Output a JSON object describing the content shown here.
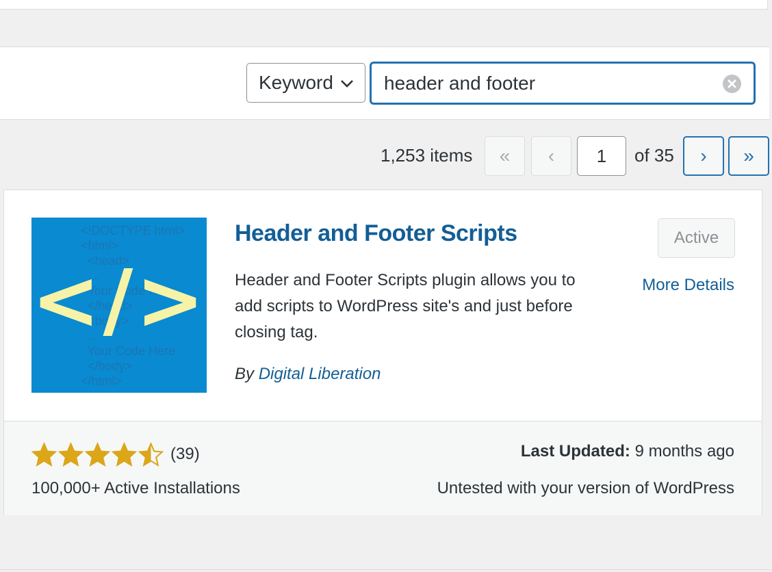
{
  "filter": {
    "search_type": "Keyword",
    "search_value": "header and footer"
  },
  "pagination": {
    "items_count": "1,253 items",
    "first": "«",
    "prev": "‹",
    "current_page": "1",
    "of_total": "of 35",
    "next": "›",
    "last": "»"
  },
  "plugin": {
    "name": "Header and Footer Scripts",
    "description": "Header and Footer Scripts plugin allows you to add scripts to WordPress site's and just before closing tag.",
    "by_label": "By",
    "author": "Digital Liberation",
    "action_label": "Active",
    "more_details": "More Details",
    "icon_glyph": "</>",
    "icon_code": "<!DOCTYPE html>\n<html>\n  <head>\n  ...\n  Your Code Here\n  </head>\n  <body>\n  ...\n  Your Code Here\n  </body>\n</html>",
    "rating_stars": 4.5,
    "rating_count": "(39)",
    "active_installs": "100,000+ Active Installations",
    "last_updated_label": "Last Updated:",
    "last_updated_value": "9 months ago",
    "compatibility": "Untested with your version of WordPress"
  },
  "colors": {
    "accent": "#2271b1",
    "link": "#135e96",
    "star": "#dba617",
    "icon_bg": "#0a8ad0"
  }
}
